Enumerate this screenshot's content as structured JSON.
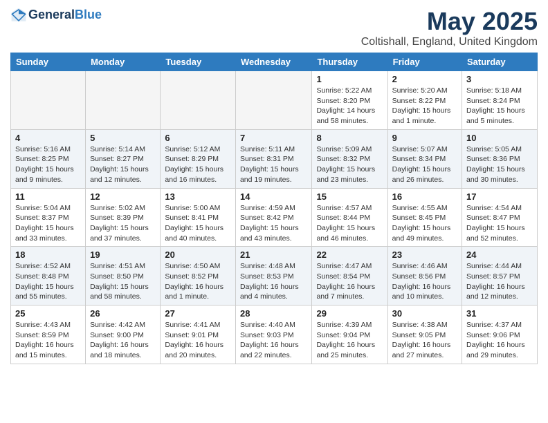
{
  "header": {
    "logo_line1": "General",
    "logo_line2": "Blue",
    "month_title": "May 2025",
    "location": "Coltishall, England, United Kingdom"
  },
  "weekdays": [
    "Sunday",
    "Monday",
    "Tuesday",
    "Wednesday",
    "Thursday",
    "Friday",
    "Saturday"
  ],
  "weeks": [
    [
      {
        "day": "",
        "info": ""
      },
      {
        "day": "",
        "info": ""
      },
      {
        "day": "",
        "info": ""
      },
      {
        "day": "",
        "info": ""
      },
      {
        "day": "1",
        "info": "Sunrise: 5:22 AM\nSunset: 8:20 PM\nDaylight: 14 hours\nand 58 minutes."
      },
      {
        "day": "2",
        "info": "Sunrise: 5:20 AM\nSunset: 8:22 PM\nDaylight: 15 hours\nand 1 minute."
      },
      {
        "day": "3",
        "info": "Sunrise: 5:18 AM\nSunset: 8:24 PM\nDaylight: 15 hours\nand 5 minutes."
      }
    ],
    [
      {
        "day": "4",
        "info": "Sunrise: 5:16 AM\nSunset: 8:25 PM\nDaylight: 15 hours\nand 9 minutes."
      },
      {
        "day": "5",
        "info": "Sunrise: 5:14 AM\nSunset: 8:27 PM\nDaylight: 15 hours\nand 12 minutes."
      },
      {
        "day": "6",
        "info": "Sunrise: 5:12 AM\nSunset: 8:29 PM\nDaylight: 15 hours\nand 16 minutes."
      },
      {
        "day": "7",
        "info": "Sunrise: 5:11 AM\nSunset: 8:31 PM\nDaylight: 15 hours\nand 19 minutes."
      },
      {
        "day": "8",
        "info": "Sunrise: 5:09 AM\nSunset: 8:32 PM\nDaylight: 15 hours\nand 23 minutes."
      },
      {
        "day": "9",
        "info": "Sunrise: 5:07 AM\nSunset: 8:34 PM\nDaylight: 15 hours\nand 26 minutes."
      },
      {
        "day": "10",
        "info": "Sunrise: 5:05 AM\nSunset: 8:36 PM\nDaylight: 15 hours\nand 30 minutes."
      }
    ],
    [
      {
        "day": "11",
        "info": "Sunrise: 5:04 AM\nSunset: 8:37 PM\nDaylight: 15 hours\nand 33 minutes."
      },
      {
        "day": "12",
        "info": "Sunrise: 5:02 AM\nSunset: 8:39 PM\nDaylight: 15 hours\nand 37 minutes."
      },
      {
        "day": "13",
        "info": "Sunrise: 5:00 AM\nSunset: 8:41 PM\nDaylight: 15 hours\nand 40 minutes."
      },
      {
        "day": "14",
        "info": "Sunrise: 4:59 AM\nSunset: 8:42 PM\nDaylight: 15 hours\nand 43 minutes."
      },
      {
        "day": "15",
        "info": "Sunrise: 4:57 AM\nSunset: 8:44 PM\nDaylight: 15 hours\nand 46 minutes."
      },
      {
        "day": "16",
        "info": "Sunrise: 4:55 AM\nSunset: 8:45 PM\nDaylight: 15 hours\nand 49 minutes."
      },
      {
        "day": "17",
        "info": "Sunrise: 4:54 AM\nSunset: 8:47 PM\nDaylight: 15 hours\nand 52 minutes."
      }
    ],
    [
      {
        "day": "18",
        "info": "Sunrise: 4:52 AM\nSunset: 8:48 PM\nDaylight: 15 hours\nand 55 minutes."
      },
      {
        "day": "19",
        "info": "Sunrise: 4:51 AM\nSunset: 8:50 PM\nDaylight: 15 hours\nand 58 minutes."
      },
      {
        "day": "20",
        "info": "Sunrise: 4:50 AM\nSunset: 8:52 PM\nDaylight: 16 hours\nand 1 minute."
      },
      {
        "day": "21",
        "info": "Sunrise: 4:48 AM\nSunset: 8:53 PM\nDaylight: 16 hours\nand 4 minutes."
      },
      {
        "day": "22",
        "info": "Sunrise: 4:47 AM\nSunset: 8:54 PM\nDaylight: 16 hours\nand 7 minutes."
      },
      {
        "day": "23",
        "info": "Sunrise: 4:46 AM\nSunset: 8:56 PM\nDaylight: 16 hours\nand 10 minutes."
      },
      {
        "day": "24",
        "info": "Sunrise: 4:44 AM\nSunset: 8:57 PM\nDaylight: 16 hours\nand 12 minutes."
      }
    ],
    [
      {
        "day": "25",
        "info": "Sunrise: 4:43 AM\nSunset: 8:59 PM\nDaylight: 16 hours\nand 15 minutes."
      },
      {
        "day": "26",
        "info": "Sunrise: 4:42 AM\nSunset: 9:00 PM\nDaylight: 16 hours\nand 18 minutes."
      },
      {
        "day": "27",
        "info": "Sunrise: 4:41 AM\nSunset: 9:01 PM\nDaylight: 16 hours\nand 20 minutes."
      },
      {
        "day": "28",
        "info": "Sunrise: 4:40 AM\nSunset: 9:03 PM\nDaylight: 16 hours\nand 22 minutes."
      },
      {
        "day": "29",
        "info": "Sunrise: 4:39 AM\nSunset: 9:04 PM\nDaylight: 16 hours\nand 25 minutes."
      },
      {
        "day": "30",
        "info": "Sunrise: 4:38 AM\nSunset: 9:05 PM\nDaylight: 16 hours\nand 27 minutes."
      },
      {
        "day": "31",
        "info": "Sunrise: 4:37 AM\nSunset: 9:06 PM\nDaylight: 16 hours\nand 29 minutes."
      }
    ]
  ]
}
